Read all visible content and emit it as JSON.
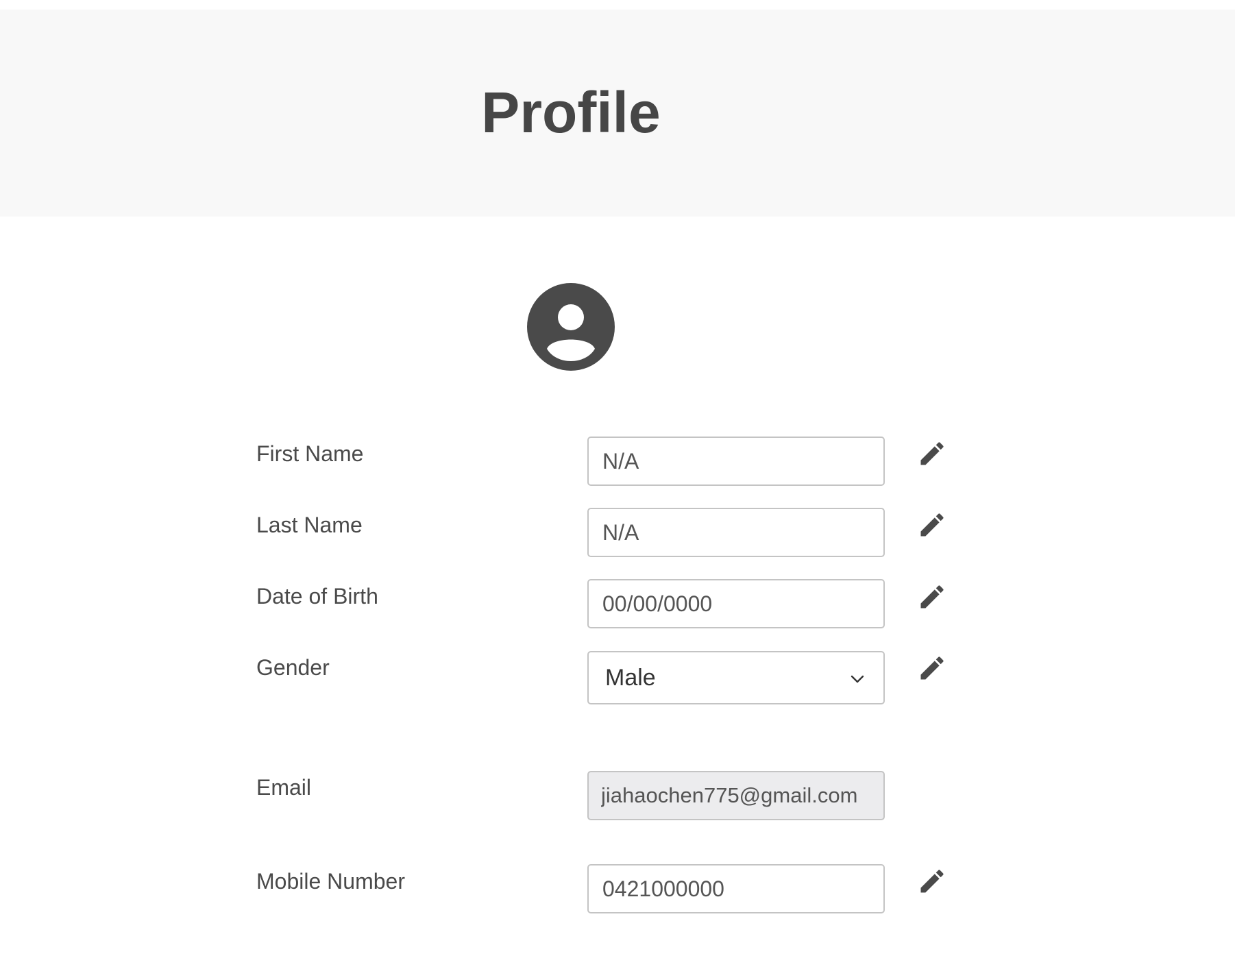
{
  "header": {
    "title": "Profile"
  },
  "avatar": {
    "icon": "account-circle-icon"
  },
  "form": {
    "first_name": {
      "label": "First Name",
      "value": "N/A"
    },
    "last_name": {
      "label": "Last Name",
      "value": "N/A"
    },
    "date_of_birth": {
      "label": "Date of Birth",
      "value": "00/00/0000"
    },
    "gender": {
      "label": "Gender",
      "value": "Male"
    },
    "email": {
      "label": "Email",
      "value": "jiahaochen775@gmail.com"
    },
    "mobile": {
      "label": "Mobile Number",
      "value": "0421000000"
    }
  },
  "icons": {
    "edit": "pencil-icon",
    "dropdown": "chevron-down-icon"
  },
  "colors": {
    "header_bg": "#f8f8f8",
    "icon": "#4a4a4a",
    "border": "#c4c4c4",
    "readonly_bg": "#ececee"
  }
}
